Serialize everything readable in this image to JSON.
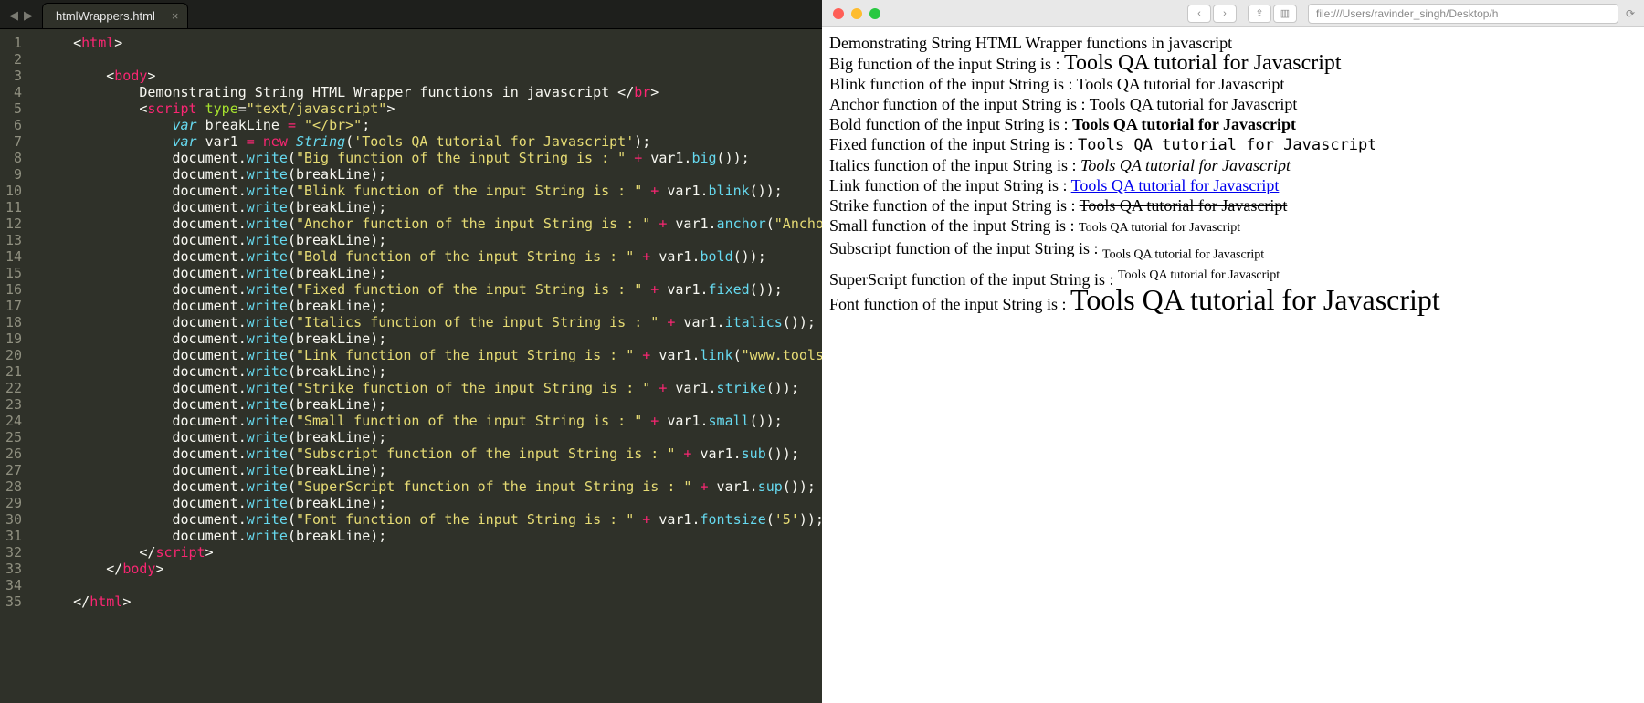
{
  "editor": {
    "tab_title": "htmlWrappers.html",
    "nav_prev_glyph": "◀",
    "nav_next_glyph": "▶",
    "close_glyph": "×",
    "js_string": "Tools QA tutorial for Javascript",
    "anchor_label": "Anchor",
    "link_url": "www.toolsQA.com",
    "fontsize_arg": "5",
    "script_type": "text/javascript",
    "header_text": "Demonstrating String HTML Wrapper functions in javascript ",
    "break_literal": "</br>",
    "functions": [
      "big",
      "blink",
      "anchor",
      "bold",
      "fixed",
      "italics",
      "link",
      "strike",
      "small",
      "sub",
      "sup",
      "fontsize"
    ],
    "labels": {
      "big": "Big",
      "blink": "Blink",
      "anchor": "Anchor",
      "bold": "Bold",
      "fixed": "Fixed",
      "italics": "Italics",
      "link": "Link",
      "strike": "Strike",
      "small": "Small",
      "sub": "Subscript",
      "sup": "SuperScript",
      "fontsize": "Font"
    },
    "line_numbers": [
      "1",
      "2",
      "3",
      "4",
      "5",
      "6",
      "7",
      "8",
      "9",
      "10",
      "11",
      "12",
      "13",
      "14",
      "15",
      "16",
      "17",
      "18",
      "19",
      "20",
      "21",
      "22",
      "23",
      "24",
      "25",
      "26",
      "27",
      "28",
      "29",
      "30",
      "31",
      "32",
      "33",
      "34",
      "35"
    ]
  },
  "browser": {
    "url": "file:///Users/ravinder_singh/Desktop/h",
    "reload_glyph": "⟳",
    "back_glyph": "‹",
    "fwd_glyph": "›",
    "share_glyph": "⇪",
    "tabs_glyph": "▥",
    "heading": "Demonstrating String HTML Wrapper functions in javascript",
    "value": "Tools QA tutorial for Javascript",
    "lines": [
      {
        "label": "Big function of the input String is : ",
        "cls": "big"
      },
      {
        "label": "Blink function of the input String is : ",
        "cls": ""
      },
      {
        "label": "Anchor function of the input String is : ",
        "cls": ""
      },
      {
        "label": "Bold function of the input String is : ",
        "cls": "bold"
      },
      {
        "label": "Fixed function of the input String is : ",
        "cls": "fixedfont"
      },
      {
        "label": "Italics function of the input String is : ",
        "cls": "ital"
      },
      {
        "label": "Link function of the input String is : ",
        "cls": "link"
      },
      {
        "label": "Strike function of the input String is : ",
        "cls": "strk"
      },
      {
        "label": "Small function of the input String is : ",
        "cls": "small"
      },
      {
        "label": "Subscript function of the input String is : ",
        "cls": "subsc"
      },
      {
        "label": "SuperScript function of the input String is : ",
        "cls": "supsc"
      },
      {
        "label": "Font function of the input String is : ",
        "cls": "fsize"
      }
    ]
  }
}
